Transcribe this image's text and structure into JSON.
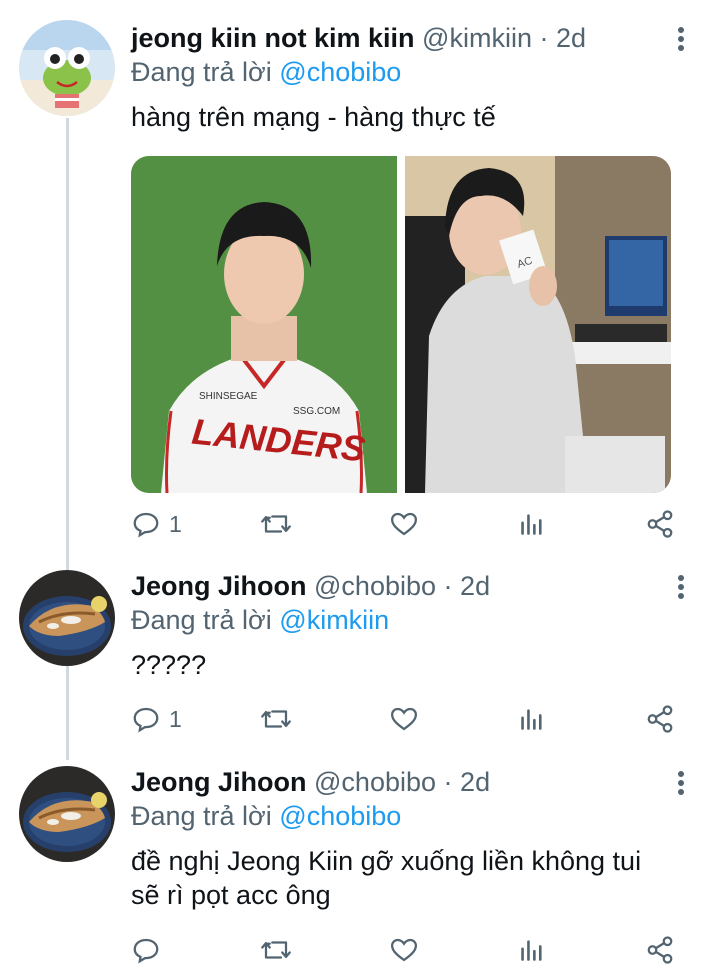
{
  "tweets": [
    {
      "name": "jeong kiin not kim kiin",
      "handle": "@kimkiin",
      "dot": "·",
      "time": "2d",
      "replying_prefix": "Đang trả lời",
      "replying_to": "@chobibo",
      "text_lines": [
        "hàng trên mạng - hàng thực tế"
      ],
      "avatar_icon": "keroppi-frog-avatar",
      "replies": "1",
      "retweets": "",
      "likes": ""
    },
    {
      "name": "Jeong Jihoon",
      "handle": "@chobibo",
      "dot": "·",
      "time": "2d",
      "replying_prefix": "Đang trả lời",
      "replying_to": "@kimkiin",
      "text_lines": [
        "?????"
      ],
      "avatar_icon": "grilled-fish-avatar",
      "replies": "1",
      "retweets": "",
      "likes": ""
    },
    {
      "name": "Jeong Jihoon",
      "handle": "@chobibo",
      "dot": "·",
      "time": "2d",
      "replying_prefix": "Đang trả lời",
      "replying_to": "@chobibo",
      "text_lines": [
        "đề nghị Jeong Kiin gỡ xuống liền không tui",
        "sẽ rì pọt acc ông"
      ],
      "avatar_icon": "grilled-fish-avatar",
      "replies": "",
      "retweets": "",
      "likes": ""
    }
  ],
  "media": {
    "left_photo": {
      "jersey_brand": "SHINSEGAE",
      "jersey_site": "SSG.COM",
      "jersey_team": "LANDERS"
    },
    "right_photo": {
      "cup_text": "AC"
    }
  },
  "colors": {
    "accent": "#1d9bf0",
    "secondary_text": "#536471",
    "primary_text": "#0f1419",
    "thread_line": "#cfd9de"
  }
}
